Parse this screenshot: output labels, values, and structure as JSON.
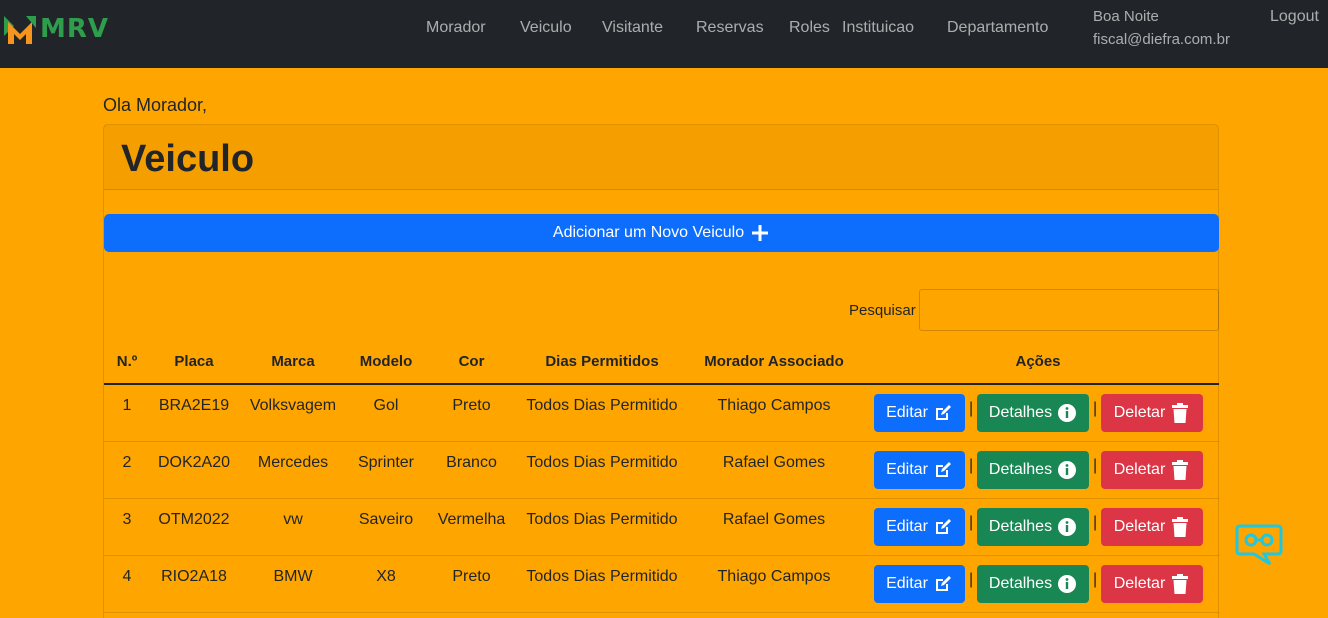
{
  "brand": {
    "name": "MRV",
    "colors": {
      "green": "#2e9e4d",
      "orange": "#f7941d"
    }
  },
  "nav": {
    "items": [
      {
        "label": "Morador"
      },
      {
        "label": "Veiculo"
      },
      {
        "label": "Visitante"
      },
      {
        "label": "Reservas"
      },
      {
        "label": "Roles"
      },
      {
        "label": "Instituicao"
      },
      {
        "label": "Departamento"
      }
    ],
    "greeting": "Boa Noite",
    "email": "fiscal@diefra.com.br",
    "logout": "Logout"
  },
  "page": {
    "hello": "Ola Morador,",
    "title": "Veiculo",
    "add_button": "Adicionar um Novo Veiculo",
    "search_label": "Pesquisar",
    "search_value": ""
  },
  "table": {
    "headers": [
      "N.º",
      "Placa",
      "Marca",
      "Modelo",
      "Cor",
      "Dias Permitidos",
      "Morador Associado",
      "Ações"
    ],
    "rows": [
      {
        "n": "1",
        "placa": "BRA2E19",
        "marca": "Volksvagem",
        "modelo": "Gol",
        "cor": "Preto",
        "dias": "Todos Dias Permitido",
        "morador": "Thiago Campos"
      },
      {
        "n": "2",
        "placa": "DOK2A20",
        "marca": "Mercedes",
        "modelo": "Sprinter",
        "cor": "Branco",
        "dias": "Todos Dias Permitido",
        "morador": "Rafael Gomes"
      },
      {
        "n": "3",
        "placa": "OTM2022",
        "marca": "vw",
        "modelo": "Saveiro",
        "cor": "Vermelha",
        "dias": "Todos Dias Permitido",
        "morador": "Rafael Gomes"
      },
      {
        "n": "4",
        "placa": "RIO2A18",
        "marca": "BMW",
        "modelo": "X8",
        "cor": "Preto",
        "dias": "Todos Dias Permitido",
        "morador": "Thiago Campos"
      }
    ],
    "actions": {
      "edit": "Editar",
      "details": "Detalhes",
      "delete": "Deletar",
      "separator": "|"
    }
  },
  "icons": {
    "add": "plus-icon",
    "edit": "edit-icon",
    "details": "info-circle-icon",
    "delete": "trash-icon",
    "chat": "chat-widget-icon"
  },
  "colors": {
    "background": "#ffa500",
    "navbar": "#212529",
    "primary": "#0d6efd",
    "success": "#198754",
    "danger": "#dc3545"
  }
}
